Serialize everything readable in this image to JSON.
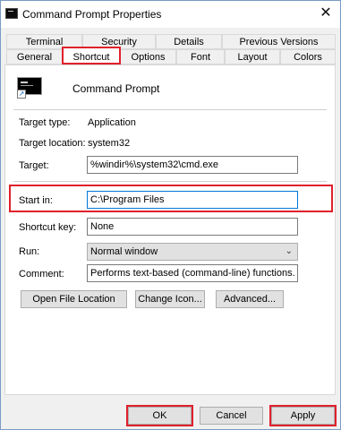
{
  "window": {
    "title": "Command Prompt Properties",
    "close": "✕"
  },
  "tabs": {
    "row1": [
      "Terminal",
      "Security",
      "Details",
      "Previous Versions"
    ],
    "row2": [
      "General",
      "Shortcut",
      "Options",
      "Font",
      "Layout",
      "Colors"
    ],
    "active": "Shortcut"
  },
  "shortcut": {
    "name": "Command Prompt",
    "target_type_label": "Target type:",
    "target_type": "Application",
    "target_location_label": "Target location:",
    "target_location": "system32",
    "target_label": "Target:",
    "target": "%windir%\\system32\\cmd.exe",
    "start_in_label": "Start in:",
    "start_in": "C:\\Program Files",
    "shortcut_key_label": "Shortcut key:",
    "shortcut_key": "None",
    "run_label": "Run:",
    "run": "Normal window",
    "comment_label": "Comment:",
    "comment": "Performs text-based (command-line) functions.",
    "open_file_location": "Open File Location",
    "change_icon": "Change Icon...",
    "advanced": "Advanced..."
  },
  "footer": {
    "ok": "OK",
    "cancel": "Cancel",
    "apply": "Apply"
  },
  "accent": {
    "highlight": "#e0202c",
    "focus": "#0078d7"
  }
}
